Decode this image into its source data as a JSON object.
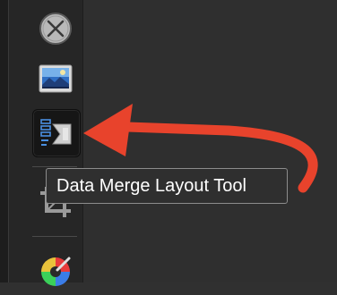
{
  "toolbar": {
    "tools": [
      {
        "name": "close-icon"
      },
      {
        "name": "picture-frame-icon"
      },
      {
        "name": "data-merge-layout-icon",
        "active": true
      },
      {
        "name": "crop-icon"
      },
      {
        "name": "color-picker-icon"
      }
    ]
  },
  "tooltip": {
    "text": "Data Merge Layout Tool"
  },
  "colors": {
    "annotation_arrow": "#e8432c",
    "accent_blue": "#4a8fe0",
    "tooltip_border": "#8c8c8c"
  }
}
